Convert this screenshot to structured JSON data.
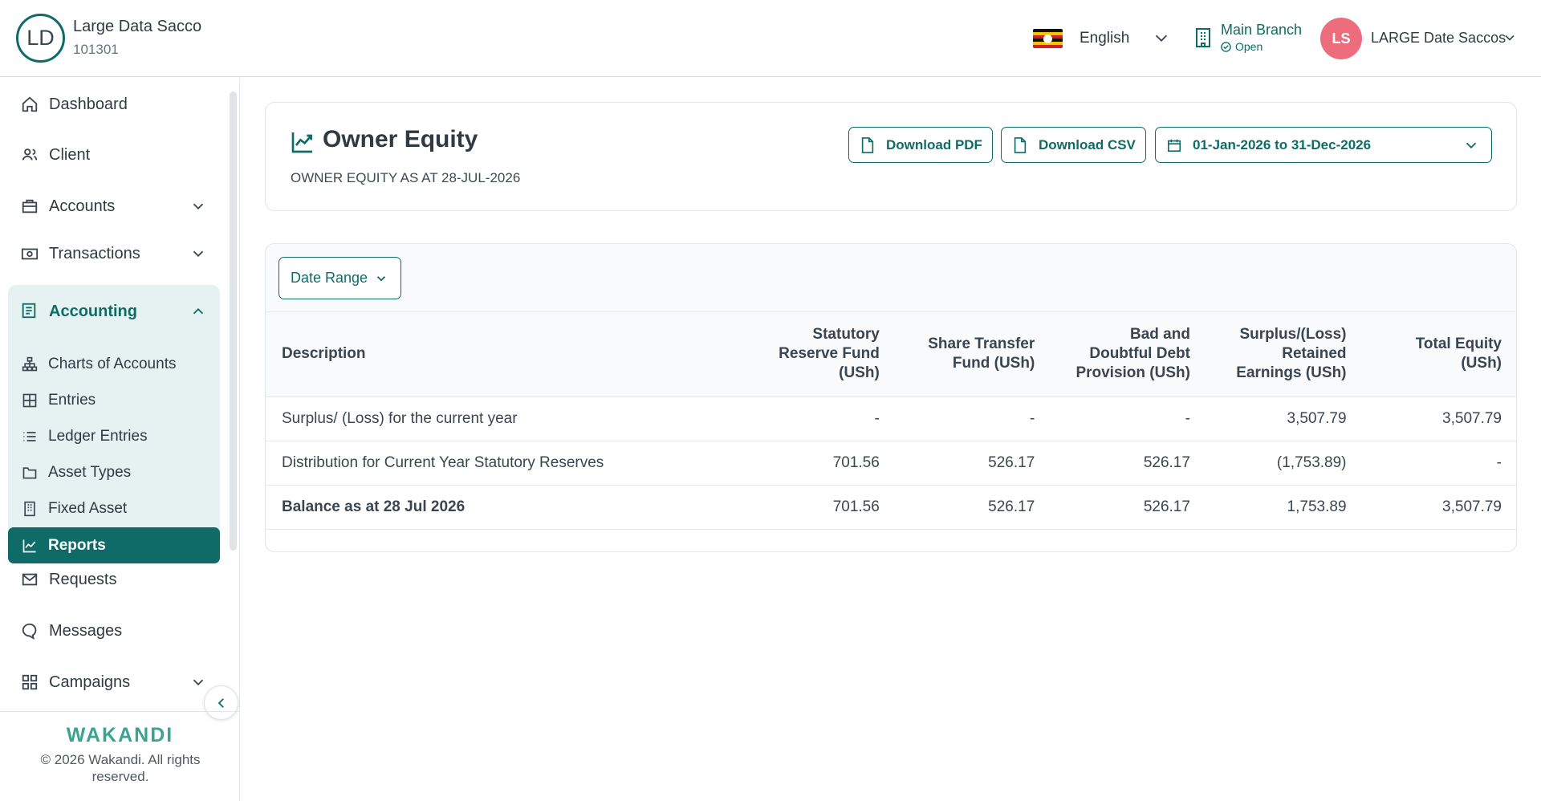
{
  "header": {
    "org_initials": "LD",
    "org_name": "Large Data Sacco",
    "org_code": "101301",
    "language": "English",
    "branch_name": "Main Branch",
    "branch_status": "Open",
    "user_initials": "LS",
    "user_name": "LARGE Date Saccos"
  },
  "sidebar": {
    "items": [
      {
        "label": "Dashboard",
        "icon": "home-icon"
      },
      {
        "label": "Client",
        "icon": "users-icon"
      },
      {
        "label": "Accounts",
        "icon": "briefcase-icon"
      },
      {
        "label": "Transactions",
        "icon": "money-icon"
      },
      {
        "label": "Accounting",
        "icon": "ledger-icon"
      },
      {
        "label": "Requests",
        "icon": "mail-icon"
      },
      {
        "label": "Messages",
        "icon": "chat-icon"
      },
      {
        "label": "Campaigns",
        "icon": "grid-icon"
      }
    ],
    "accounting_sub": [
      {
        "label": "Charts of Accounts"
      },
      {
        "label": "Entries"
      },
      {
        "label": "Ledger Entries"
      },
      {
        "label": "Asset Types"
      },
      {
        "label": "Fixed Asset"
      },
      {
        "label": "Reports"
      }
    ],
    "brand": "WAKANDI",
    "copyright": "© 2026 Wakandi. All rights reserved."
  },
  "page": {
    "title": "Owner Equity",
    "subtitle": "OWNER EQUITY AS AT 28-JUL-2026",
    "download_pdf": "Download PDF",
    "download_csv": "Download CSV",
    "date_range_value": "01-Jan-2026 to 31-Dec-2026",
    "filter_label": "Date Range"
  },
  "table": {
    "columns": [
      "Description",
      "Statutory Reserve Fund (USh)",
      "Share Transfer Fund (USh)",
      "Bad and Doubtful Debt Provision (USh)",
      "Surplus/(Loss) Retained Earnings (USh)",
      "Total Equity (USh)"
    ],
    "rows": [
      [
        "Surplus/ (Loss) for the current year",
        "-",
        "-",
        "-",
        "3,507.79",
        "3,507.79"
      ],
      [
        "Distribution for Current Year Statutory Reserves",
        "701.56",
        "526.17",
        "526.17",
        "(1,753.89)",
        "-"
      ],
      [
        "Balance as at 28 Jul 2026",
        "701.56",
        "526.17",
        "526.17",
        "1,753.89",
        "3,507.79"
      ]
    ]
  },
  "colors": {
    "accent": "#0f6b67",
    "accent_light": "#e6f2f1",
    "avatar": "#ee6d7d"
  }
}
